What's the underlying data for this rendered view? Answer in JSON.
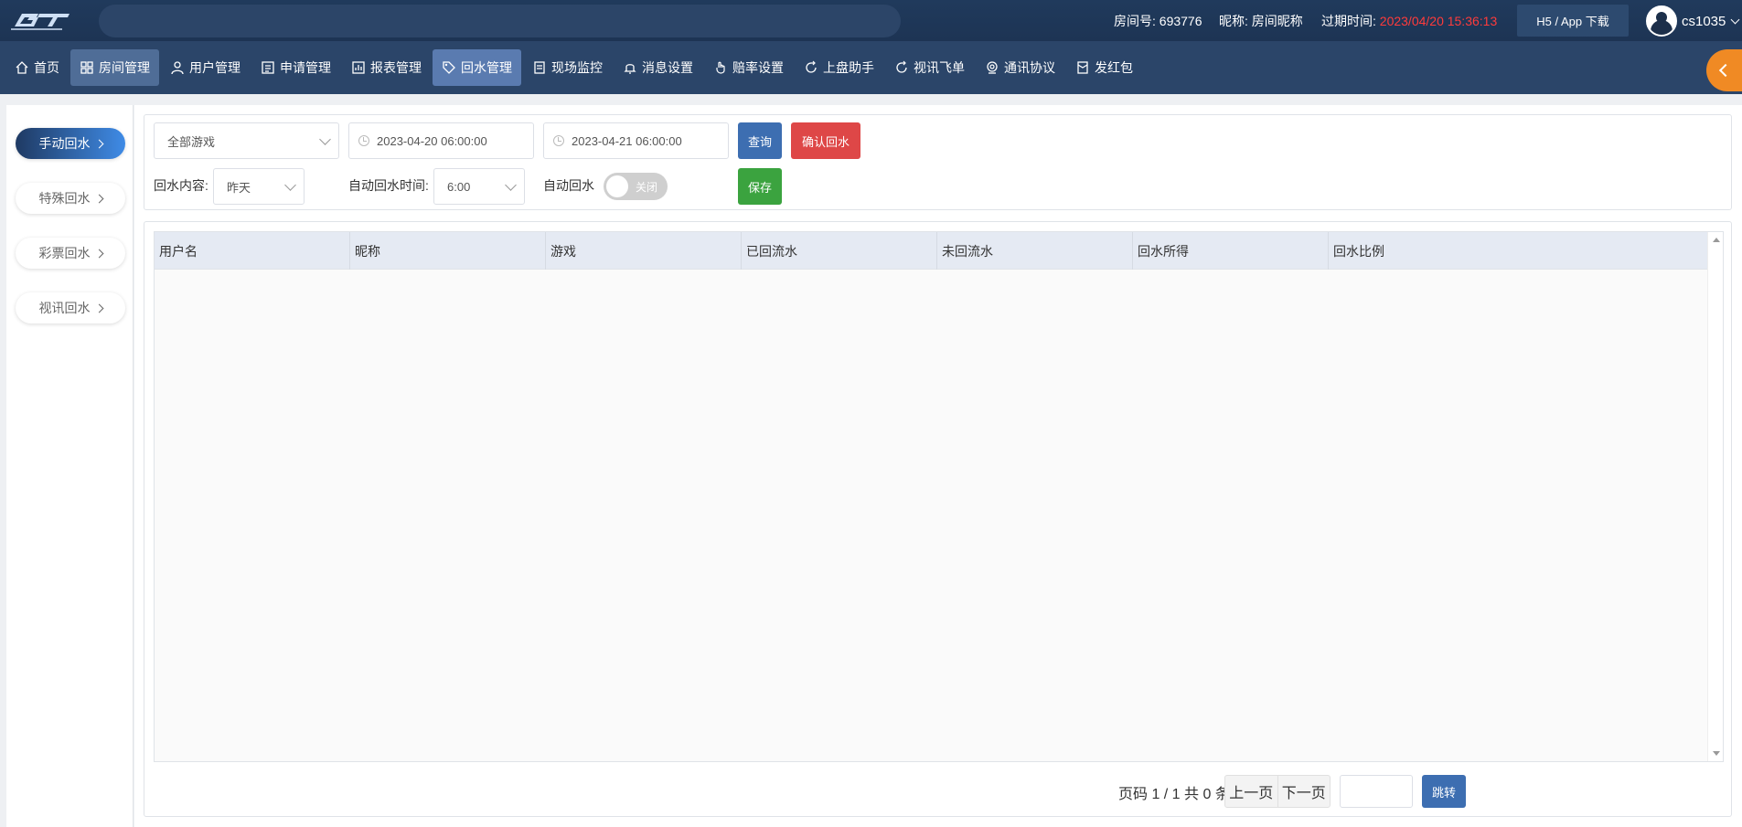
{
  "topbar": {
    "logo_text": "GT",
    "room_no_label": "房间号:",
    "room_no": "693776",
    "nickname_label": "昵称:",
    "nickname": "房间昵称",
    "expire_label": "过期时间:",
    "expire_value": "2023/04/20 15:36:13",
    "download_label": "H5 / App 下载",
    "username": "cs1035"
  },
  "nav": {
    "items": [
      {
        "label": "首页",
        "icon": "home-icon"
      },
      {
        "label": "房间管理",
        "icon": "grid-icon"
      },
      {
        "label": "用户管理",
        "icon": "user-icon"
      },
      {
        "label": "申请管理",
        "icon": "form-icon"
      },
      {
        "label": "报表管理",
        "icon": "report-icon"
      },
      {
        "label": "回水管理",
        "icon": "tag-icon"
      },
      {
        "label": "现场监控",
        "icon": "monitor-icon"
      },
      {
        "label": "消息设置",
        "icon": "bell-icon"
      },
      {
        "label": "赔率设置",
        "icon": "hand-icon"
      },
      {
        "label": "上盘助手",
        "icon": "refresh-icon"
      },
      {
        "label": "视讯飞单",
        "icon": "refresh-icon"
      },
      {
        "label": "通讯协议",
        "icon": "webcam-icon"
      },
      {
        "label": "发红包",
        "icon": "redpacket-icon"
      }
    ]
  },
  "sidebar": {
    "items": [
      "手动回水",
      "特殊回水",
      "彩票回水",
      "视讯回水"
    ]
  },
  "filters": {
    "game_select": "全部游戏",
    "start_date": "2023-04-20 06:00:00",
    "end_date": "2023-04-21 06:00:00",
    "query_label": "查询",
    "confirm_label": "确认回水",
    "content_label": "回水内容:",
    "content_value": "昨天",
    "auto_time_label": "自动回水时间:",
    "auto_time_value": "6:00",
    "auto_label": "自动回水",
    "toggle_label": "关闭",
    "save_label": "保存"
  },
  "table": {
    "columns": [
      "用户名",
      "昵称",
      "游戏",
      "已回流水",
      "未回流水",
      "回水所得",
      "回水比例"
    ]
  },
  "pager": {
    "info": "页码 1 / 1 共 0 条",
    "prev_label": "上一页",
    "next_label": "下一页",
    "jump_label": "跳转"
  },
  "colors": {
    "topbar_bg": "#203a5c",
    "navbar_bg": "#2b4569",
    "accent_blue": "#3d6eb1",
    "danger_red": "#de4747",
    "success_green": "#3ba33f",
    "collapse_orange": "#f08a24",
    "expire_red": "#ff3b3b"
  }
}
